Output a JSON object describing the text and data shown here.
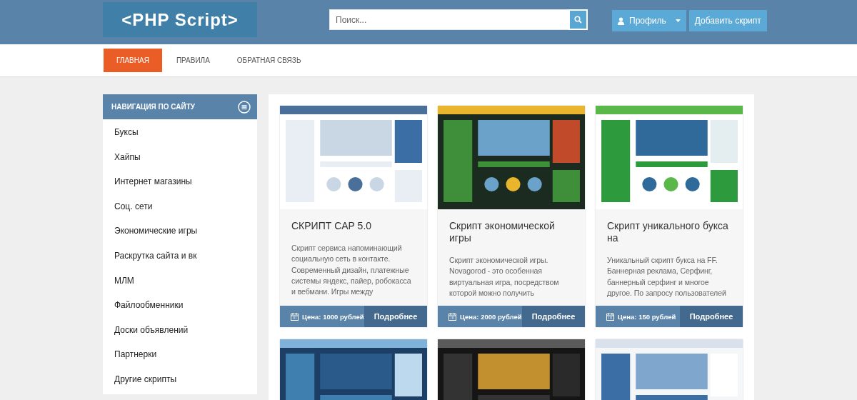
{
  "header": {
    "logo": "<PHP Script>",
    "search": {
      "placeholder": "Поиск..."
    },
    "profile_button": "Профиль",
    "add_button": "Добавить скрипт"
  },
  "nav": [
    {
      "label": "ГЛАВНАЯ",
      "selected": true
    },
    {
      "label": "ПРАВИЛА",
      "selected": false
    },
    {
      "label": "ОБРАТНАЯ СВЯЗЬ",
      "selected": false
    }
  ],
  "sidebar": {
    "title": "НАВИГАЦИЯ ПО САЙТУ",
    "items": [
      "Буксы",
      "Хайпы",
      "Интернет магазины",
      "Соц. сети",
      "Экономические игры",
      "Раскрутка сайта и вк",
      "МЛМ",
      "Файлообменники",
      "Доски объявлений",
      "Партнерки",
      "Другие скрипты"
    ]
  },
  "cards": [
    {
      "title": "СКРИПТ CAP 5.0",
      "description": "Скрипт сервиса напоминающий социальную сеть в контакте. Современный дизайн, платежные системы яндекс, пайер, робокасса и вебмани. Игры между",
      "price": "Цена: 1000 рублей",
      "button": "Подробнее"
    },
    {
      "title": "Скрипт экономической игры",
      "description": "Скрипт экономической игры. Novagorod - это особенная виртуальная игра, посредством которой можно получить",
      "price": "Цена: 2000 рублей",
      "button": "Подробнее"
    },
    {
      "title": "Скрипт уникального букса на",
      "description": "Уникальный скрипт букса на FF. Баннерная реклама, Серфинг, баннерный серфинг и многое другое. По запросу пользователей",
      "price": "Цена: 150 рублей",
      "button": "Подробнее"
    }
  ]
}
